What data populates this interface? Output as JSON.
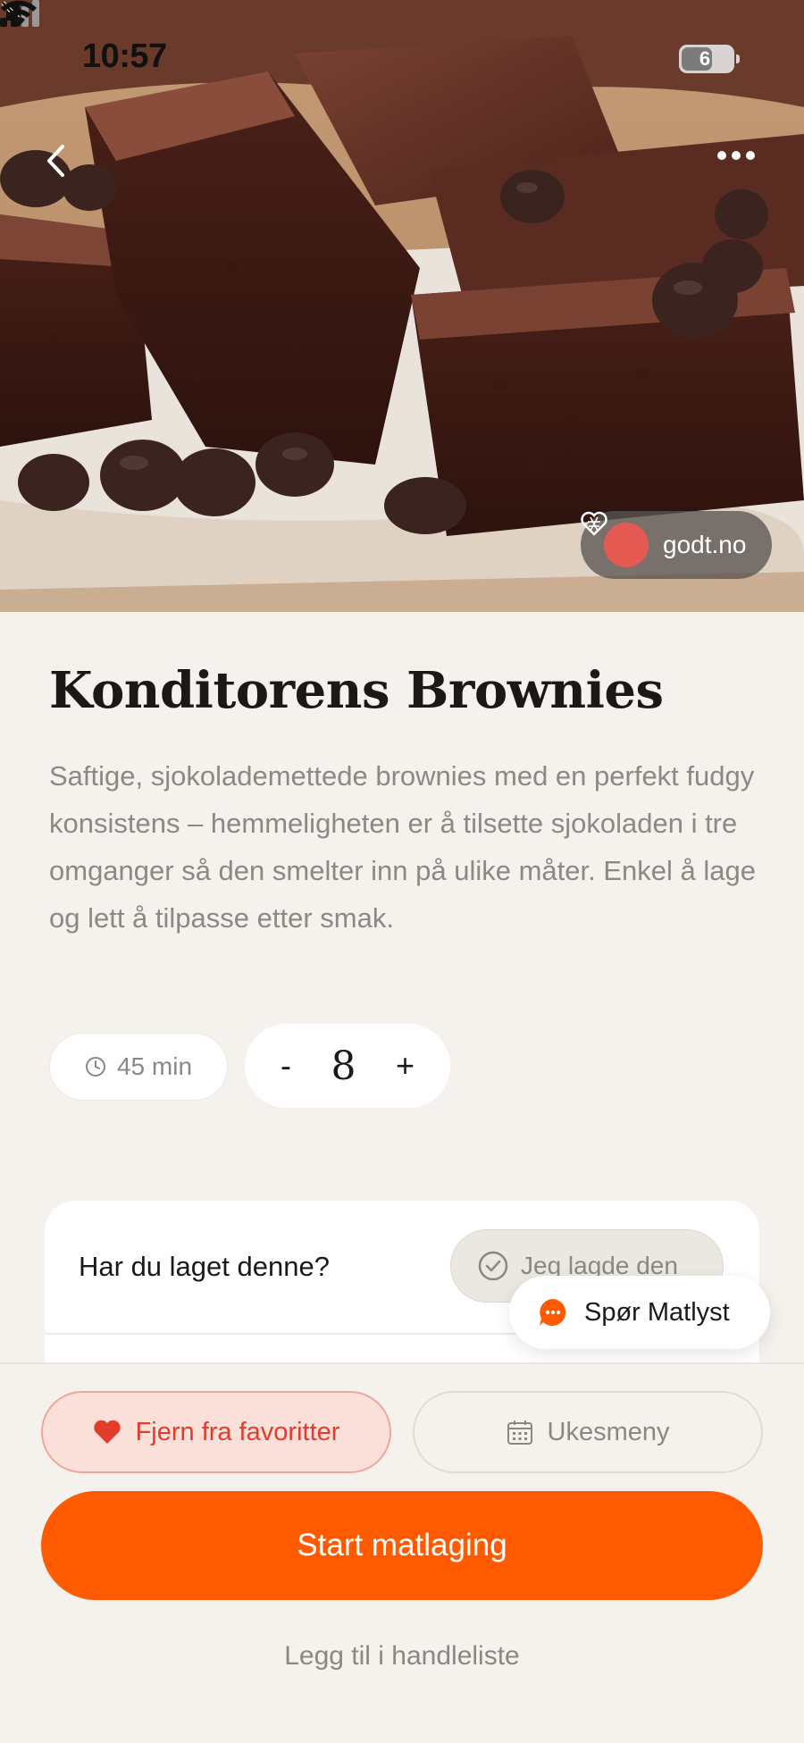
{
  "status_bar": {
    "time": "10:57",
    "battery": "6"
  },
  "hero": {
    "source": "godt.no"
  },
  "recipe": {
    "title": "Konditorens Brownies",
    "description": "Saftige, sjokolademettede brownies med en perfekt fudgy konsistens – hemmeligheten er å tilsette sjokoladen i tre omganger så den smelter inn på ulike måter. Enkel å lage og lett å tilpasse etter smak.",
    "time": "45 min",
    "servings": {
      "minus": "-",
      "count": "8",
      "plus": "+"
    }
  },
  "made_card": {
    "question": "Har du laget denne?",
    "button": "Jeg lagde den"
  },
  "ask": {
    "label": "Spør Matlyst"
  },
  "actions": {
    "favorite": "Fjern fra favoritter",
    "week_menu": "Ukesmeny",
    "start": "Start matlaging",
    "shopping_list": "Legg til i handleliste"
  },
  "colors": {
    "accent": "#ff5a00",
    "favorite": "#e23c2b",
    "background": "#f5f2ed"
  },
  "icons": [
    "back-arrow-icon",
    "more-dots-icon",
    "bell-slash-icon",
    "signal-icon",
    "wifi-icon",
    "clock-icon",
    "check-circle-icon",
    "chat-icon",
    "heart-icon",
    "calendar-icon"
  ]
}
